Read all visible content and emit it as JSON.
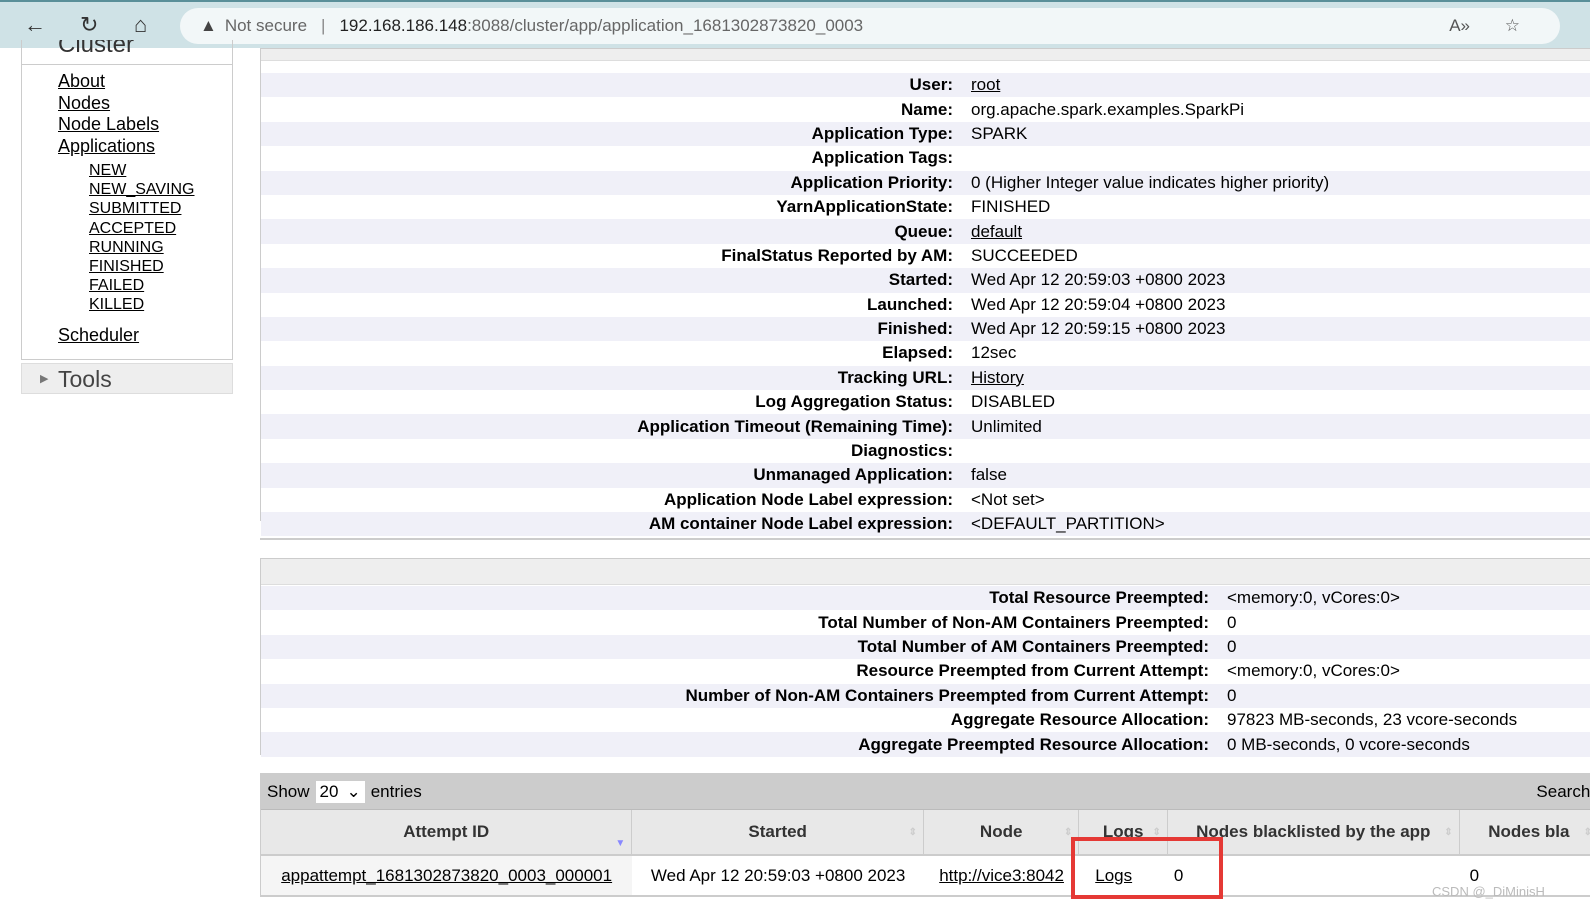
{
  "browser": {
    "security": "Not secure",
    "url_host": "192.168.186.148",
    "url_path": ":8088/cluster/app/application_1681302873820_0003"
  },
  "sidebar": {
    "section": "Cluster",
    "items": [
      "About",
      "Nodes",
      "Node Labels",
      "Applications"
    ],
    "states": [
      "NEW",
      "NEW_SAVING",
      "SUBMITTED",
      "ACCEPTED",
      "RUNNING",
      "FINISHED",
      "FAILED",
      "KILLED"
    ],
    "scheduler": "Scheduler",
    "tools": "Tools"
  },
  "app_info": [
    [
      "User:",
      "root"
    ],
    [
      "Name:",
      "org.apache.spark.examples.SparkPi"
    ],
    [
      "Application Type:",
      "SPARK"
    ],
    [
      "Application Tags:",
      ""
    ],
    [
      "Application Priority:",
      "0 (Higher Integer value indicates higher priority)"
    ],
    [
      "YarnApplicationState:",
      "FINISHED"
    ],
    [
      "Queue:",
      "default"
    ],
    [
      "FinalStatus Reported by AM:",
      "SUCCEEDED"
    ],
    [
      "Started:",
      "Wed Apr 12 20:59:03 +0800 2023"
    ],
    [
      "Launched:",
      "Wed Apr 12 20:59:04 +0800 2023"
    ],
    [
      "Finished:",
      "Wed Apr 12 20:59:15 +0800 2023"
    ],
    [
      "Elapsed:",
      "12sec"
    ],
    [
      "Tracking URL:",
      "History"
    ],
    [
      "Log Aggregation Status:",
      "DISABLED"
    ],
    [
      "Application Timeout (Remaining Time):",
      "Unlimited"
    ],
    [
      "Diagnostics:",
      ""
    ],
    [
      "Unmanaged Application:",
      "false"
    ],
    [
      "Application Node Label expression:",
      "<Not set>"
    ],
    [
      "AM container Node Label expression:",
      "<DEFAULT_PARTITION>"
    ]
  ],
  "preempt_info": [
    [
      "Total Resource Preempted:",
      "<memory:0, vCores:0>"
    ],
    [
      "Total Number of Non-AM Containers Preempted:",
      "0"
    ],
    [
      "Total Number of AM Containers Preempted:",
      "0"
    ],
    [
      "Resource Preempted from Current Attempt:",
      "<memory:0, vCores:0>"
    ],
    [
      "Number of Non-AM Containers Preempted from Current Attempt:",
      "0"
    ],
    [
      "Aggregate Resource Allocation:",
      "97823 MB-seconds, 23 vcore-seconds"
    ],
    [
      "Aggregate Preempted Resource Allocation:",
      "0 MB-seconds, 0 vcore-seconds"
    ]
  ],
  "attempts": {
    "show": "Show",
    "entries_value": "20",
    "entries": "entries",
    "search": "Search:",
    "columns": [
      "Attempt ID",
      "Started",
      "Node",
      "Logs",
      "Nodes blacklisted by the app",
      "Nodes bla"
    ],
    "rows": [
      [
        "appattempt_1681302873820_0003_000001",
        "Wed Apr 12 20:59:03 +0800 2023",
        "http://vice3:8042",
        "Logs",
        "0",
        "0"
      ]
    ]
  },
  "watermark": "CSDN @_DiMinisH"
}
